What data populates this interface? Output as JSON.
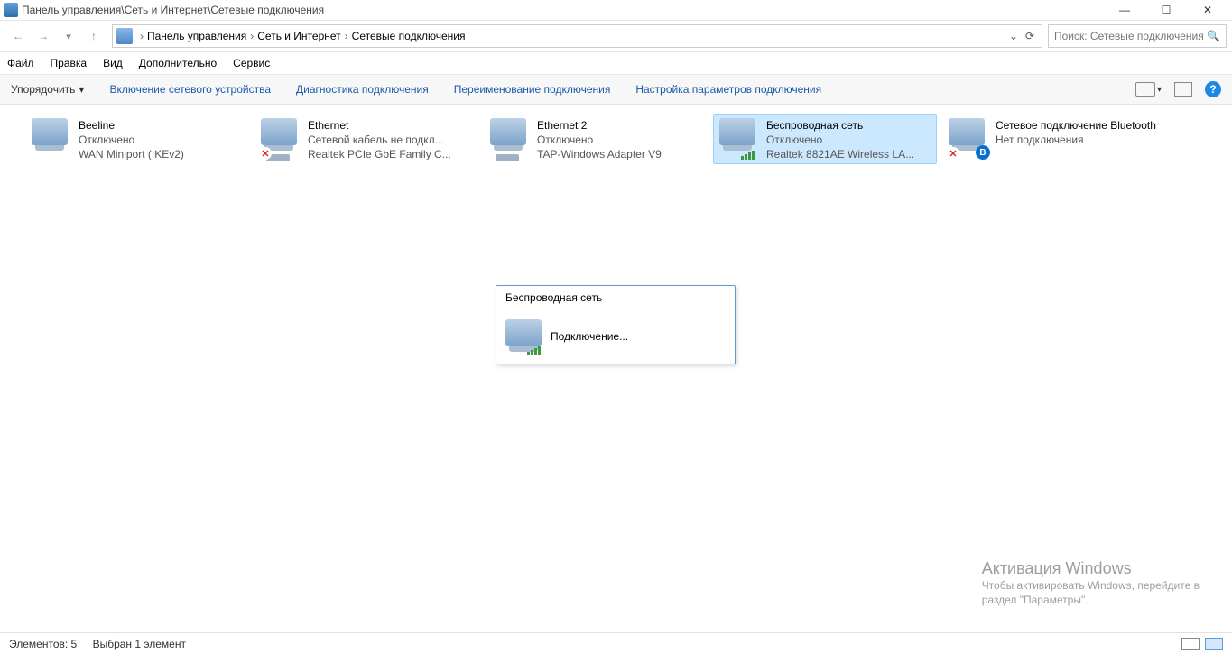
{
  "window": {
    "title": "Панель управления\\Сеть и Интернет\\Сетевые подключения"
  },
  "breadcrumbs": {
    "a": "Панель управления",
    "b": "Сеть и Интернет",
    "c": "Сетевые подключения"
  },
  "search": {
    "placeholder": "Поиск: Сетевые подключения"
  },
  "menu": {
    "file": "Файл",
    "edit": "Правка",
    "view": "Вид",
    "extra": "Дополнительно",
    "service": "Сервис"
  },
  "toolbar": {
    "organize": "Упорядочить",
    "enable": "Включение сетевого устройства",
    "diagnose": "Диагностика подключения",
    "rename": "Переименование подключения",
    "settings": "Настройка параметров подключения"
  },
  "adapters": [
    {
      "name": "Beeline",
      "status": "Отключено",
      "driver": "WAN Miniport (IKEv2)"
    },
    {
      "name": "Ethernet",
      "status": "Сетевой кабель не подкл...",
      "driver": "Realtek PCIe GbE Family C..."
    },
    {
      "name": "Ethernet 2",
      "status": "Отключено",
      "driver": "TAP-Windows Adapter V9"
    },
    {
      "name": "Беспроводная сеть",
      "status": "Отключено",
      "driver": "Realtek 8821AE Wireless LA..."
    },
    {
      "name": "Сетевое подключение Bluetooth",
      "status": "Нет подключения",
      "driver": ""
    }
  ],
  "popup": {
    "title": "Беспроводная сеть",
    "text": "Подключение..."
  },
  "watermark": {
    "h": "Активация Windows",
    "p1": "Чтобы активировать Windows, перейдите в",
    "p2": "раздел \"Параметры\"."
  },
  "status": {
    "count": "Элементов: 5",
    "selected": "Выбран 1 элемент"
  }
}
